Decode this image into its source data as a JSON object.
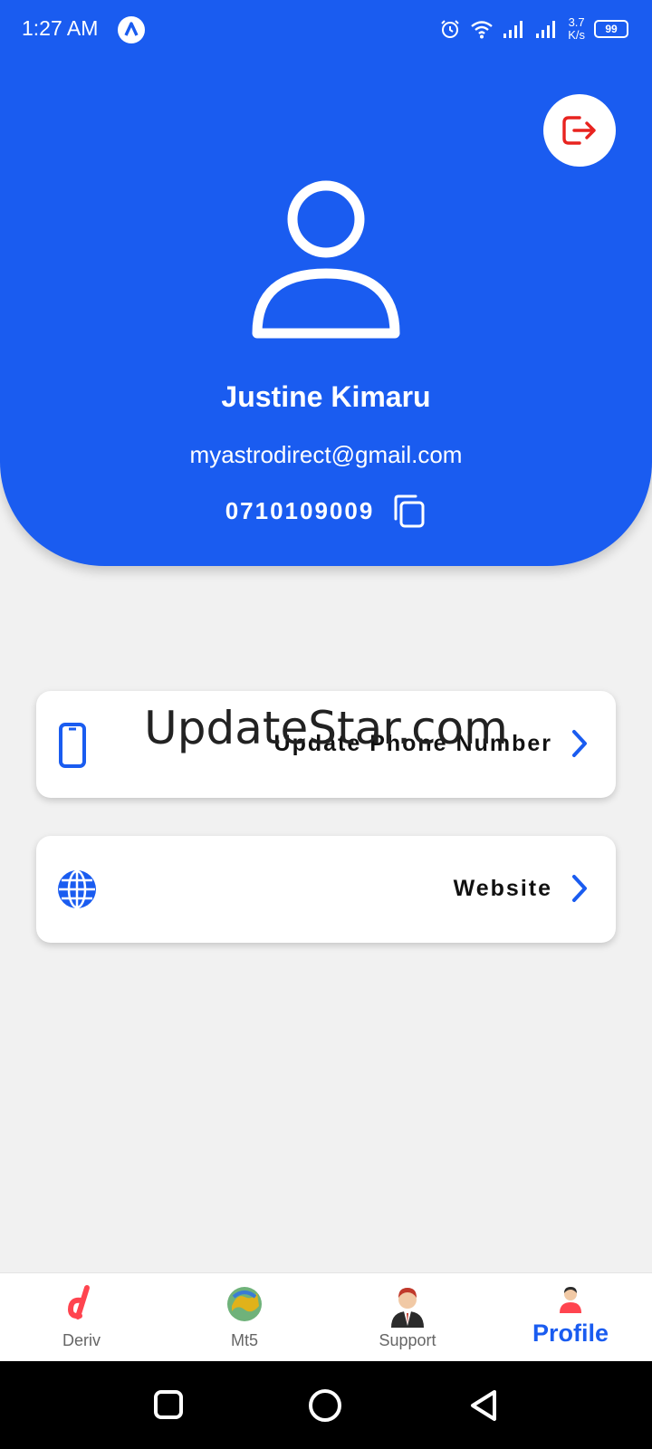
{
  "status_bar": {
    "time": "1:27 AM",
    "net_speed_value": "3.7",
    "net_speed_unit": "K/s",
    "battery": "99"
  },
  "profile": {
    "name": "Justine Kimaru",
    "email": "myastrodirect@gmail.com",
    "phone": "0710109009"
  },
  "menu": {
    "update_phone_label": "Update Phone Number",
    "website_label": "Website"
  },
  "watermark": "UpdateStar.com",
  "bottom_nav": {
    "items": [
      {
        "label": "Deriv"
      },
      {
        "label": "Mt5"
      },
      {
        "label": "Support"
      },
      {
        "label": "Profile"
      }
    ],
    "active": "Profile"
  },
  "colors": {
    "primary": "#1a5cf0",
    "logout": "#e8231f",
    "deriv": "#ff444f",
    "background": "#f1f1f1"
  }
}
